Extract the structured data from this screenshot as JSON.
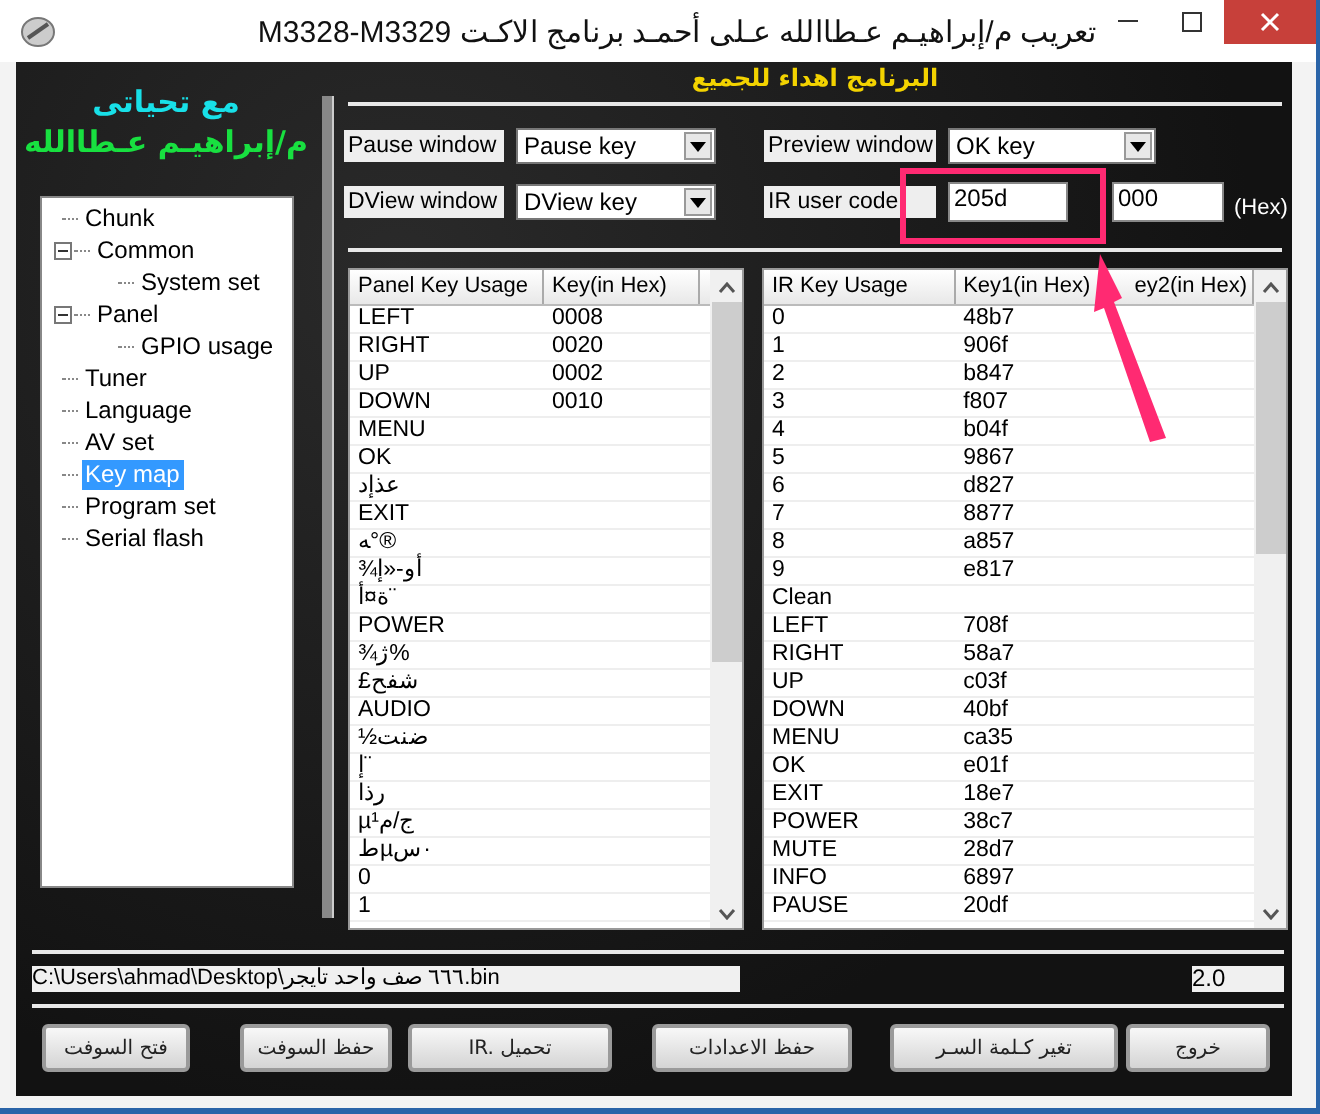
{
  "window": {
    "title": "تعريب م/إبراهيـم عـطاالله عـلى أحمـد   برنامج الاكـت M3328-M3329"
  },
  "dedication": [
    {
      "text": "مع تحياتى",
      "color": "#18e0e8"
    },
    {
      "text": "م/إبراهيـم عـطاالله",
      "color": "#18e040"
    }
  ],
  "banner": "البرنامج اهداء للجميع",
  "settings": [
    {
      "kind": "dropdown",
      "label": "Pause window",
      "value": "Pause key"
    },
    {
      "kind": "dropdown",
      "label": "Preview window",
      "value": "OK key"
    },
    {
      "kind": "dropdown",
      "label": "DView window",
      "value": "DView key"
    },
    {
      "kind": "code",
      "label": "IR user code",
      "value": "205d",
      "value2": "000",
      "unit": "(Hex)"
    }
  ],
  "tree": [
    {
      "label": "Chunk",
      "selected": false
    },
    {
      "label": "Common",
      "selected": false,
      "expanded": true,
      "children": [
        {
          "label": "System set",
          "selected": false
        }
      ]
    },
    {
      "label": "Panel",
      "selected": false,
      "expanded": true,
      "children": [
        {
          "label": "GPIO usage",
          "selected": false
        }
      ]
    },
    {
      "label": "Tuner",
      "selected": false
    },
    {
      "label": "Language",
      "selected": false
    },
    {
      "label": "AV set",
      "selected": false
    },
    {
      "label": "Key map",
      "selected": true
    },
    {
      "label": "Program set",
      "selected": false
    },
    {
      "label": "Serial flash",
      "selected": false
    }
  ],
  "panel_table": {
    "columns": [
      "Panel Key Usage",
      "Key(in Hex)"
    ],
    "rows": [
      [
        "LEFT",
        "0008"
      ],
      [
        "RIGHT",
        "0020"
      ],
      [
        "UP",
        "0002"
      ],
      [
        "DOWN",
        "0010"
      ],
      [
        "MENU"
      ],
      [
        "OK"
      ],
      [
        "عذإد"
      ],
      [
        "EXIT"
      ],
      [
        "ﻪ°®"
      ],
      [
        "¾أو-«إ"
      ],
      [
        "ة¤أ¨"
      ],
      [
        "POWER"
      ],
      [
        "¾ژ%"
      ],
      [
        "£شفح"
      ],
      [
        "AUDIO"
      ],
      [
        "½ضنت"
      ],
      [
        "إ¨"
      ],
      [
        "رذا"
      ],
      [
        "µج/م¹"
      ],
      [
        "طµس·"
      ],
      [
        "0"
      ],
      [
        "1"
      ]
    ]
  },
  "ir_table": {
    "columns": [
      "IR Key Usage",
      "Key1(in Hex)",
      "ey2(in Hex)"
    ],
    "rows": [
      [
        "0",
        "48b7"
      ],
      [
        "1",
        "906f"
      ],
      [
        "2",
        "b847"
      ],
      [
        "3",
        "f807"
      ],
      [
        "4",
        "b04f"
      ],
      [
        "5",
        "9867"
      ],
      [
        "6",
        "d827"
      ],
      [
        "7",
        "8877"
      ],
      [
        "8",
        "a857"
      ],
      [
        "9",
        "e817"
      ],
      [
        "Clean"
      ],
      [
        "LEFT",
        "708f"
      ],
      [
        "RIGHT",
        "58a7"
      ],
      [
        "UP",
        "c03f"
      ],
      [
        "DOWN",
        "40bf"
      ],
      [
        "MENU",
        "ca35"
      ],
      [
        "OK",
        "e01f"
      ],
      [
        "EXIT",
        "18e7"
      ],
      [
        "POWER",
        "38c7"
      ],
      [
        "MUTE",
        "28d7"
      ],
      [
        "INFO",
        "6897"
      ],
      [
        "PAUSE",
        "20df"
      ]
    ]
  },
  "status": {
    "path": "C:\\Users\\ahmad\\Desktop\\٦٦٦ صف واحد تايجر.bin",
    "version": "2.0"
  },
  "buttons": [
    "خروج",
    "تغير كـلمة السـر",
    "حفظ الاعدادات",
    "IR. تحميل",
    "حفظ السوفت",
    "فتح السوفت"
  ]
}
